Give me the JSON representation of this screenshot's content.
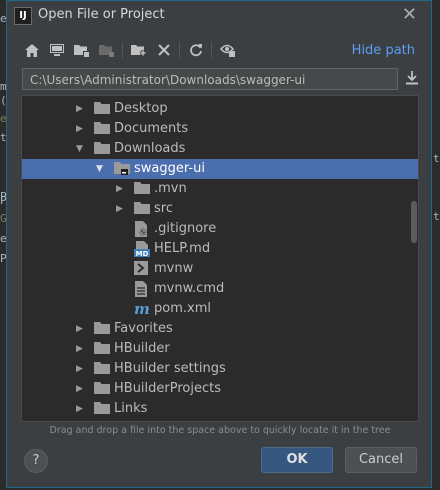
{
  "dialog": {
    "title": "Open File or Project",
    "app_icon_text": "IJ",
    "hide_path_label": "Hide path",
    "path_value": "C:\\Users\\Administrator\\Downloads\\swagger-ui",
    "hint_text": "Drag and drop a file into the space above to quickly locate it in the tree",
    "help_label": "?",
    "ok_label": "OK",
    "cancel_label": "Cancel"
  },
  "toolbar": {
    "buttons": [
      {
        "name": "home-icon",
        "enabled": true
      },
      {
        "name": "desktop-icon",
        "enabled": true
      },
      {
        "name": "project-directory-icon",
        "enabled": true
      },
      {
        "name": "module-directory-icon",
        "enabled": false
      },
      {
        "name": "new-folder-icon",
        "enabled": true
      },
      {
        "name": "delete-icon",
        "enabled": true
      },
      {
        "name": "refresh-icon",
        "enabled": true
      },
      {
        "name": "show-hidden-files-icon",
        "enabled": true
      }
    ]
  },
  "tree": {
    "items": [
      {
        "label": "Desktop",
        "level": 0,
        "type": "folder",
        "expanded": false
      },
      {
        "label": "Documents",
        "level": 0,
        "type": "folder",
        "expanded": false
      },
      {
        "label": "Downloads",
        "level": 0,
        "type": "folder",
        "expanded": true
      },
      {
        "label": "swagger-ui",
        "level": 1,
        "type": "folder-project",
        "expanded": true,
        "selected": true
      },
      {
        "label": ".mvn",
        "level": 2,
        "type": "folder",
        "expanded": false
      },
      {
        "label": "src",
        "level": 2,
        "type": "folder",
        "expanded": false
      },
      {
        "label": ".gitignore",
        "level": 2,
        "type": "gitignore-file"
      },
      {
        "label": "HELP.md",
        "level": 2,
        "type": "markdown-file"
      },
      {
        "label": "mvnw",
        "level": 2,
        "type": "shell-file"
      },
      {
        "label": "mvnw.cmd",
        "level": 2,
        "type": "text-file"
      },
      {
        "label": "pom.xml",
        "level": 2,
        "type": "maven-file"
      },
      {
        "label": "Favorites",
        "level": 0,
        "type": "folder",
        "expanded": false
      },
      {
        "label": "HBuilder",
        "level": 0,
        "type": "folder",
        "expanded": false
      },
      {
        "label": "HBuilder settings",
        "level": 0,
        "type": "folder",
        "expanded": false
      },
      {
        "label": "HBuilderProjects",
        "level": 0,
        "type": "folder",
        "expanded": false
      },
      {
        "label": "Links",
        "level": 0,
        "type": "folder",
        "expanded": false
      }
    ]
  },
  "background_fragments": [
    "e",
    "m",
    "(",
    "e",
    "t",
    "P",
    "P",
    "G",
    "e",
    "P",
    "t",
    "t"
  ]
}
